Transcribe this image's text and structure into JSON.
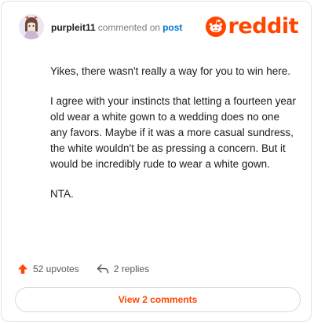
{
  "header": {
    "username": "purpleit11",
    "action_text": "commented on",
    "post_link": "post",
    "brand": "reddit"
  },
  "comment": {
    "paragraphs": [
      "Yikes, there wasn't really a way for you to win here.",
      "I agree with your instincts that letting a fourteen year old wear a white gown to a wedding does no one any favors. Maybe if it was a more casual sundress, the white wouldn't be as pressing a concern. But it would be incredibly rude to wear a white gown.",
      "NTA."
    ]
  },
  "actions": {
    "upvotes": "52 upvotes",
    "replies": "2 replies"
  },
  "footer": {
    "view_comments": "View 2 comments"
  },
  "colors": {
    "brand": "#ff4500",
    "link": "#0079d3",
    "text": "#1c1c1c",
    "muted": "#7c7c7c"
  },
  "icons": [
    "avatar",
    "reddit-logo-icon",
    "upvote-arrow-icon",
    "reply-arrow-icon"
  ]
}
